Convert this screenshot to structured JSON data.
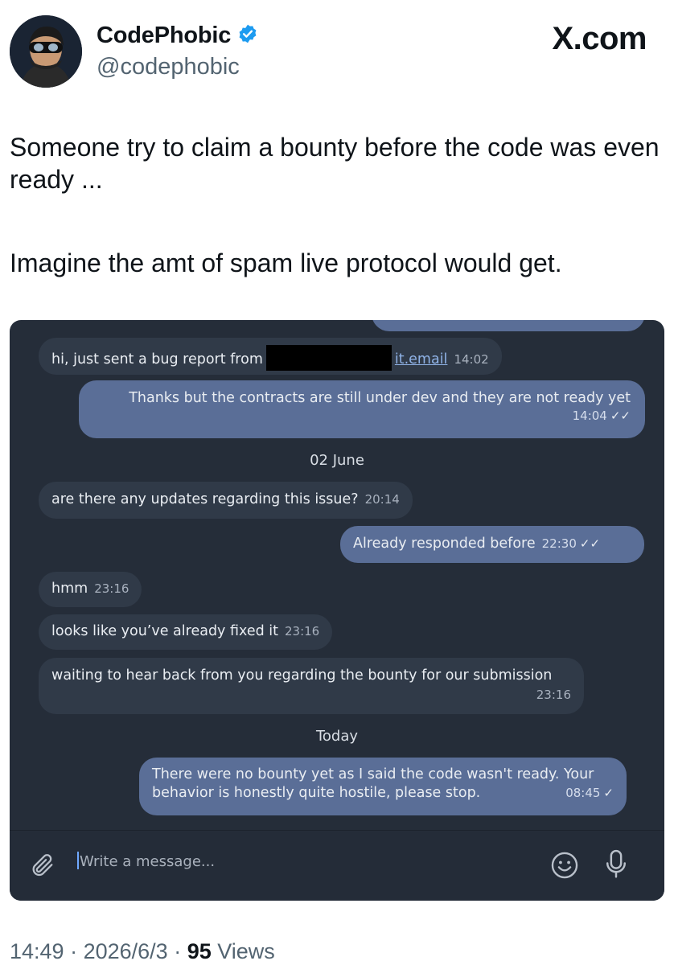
{
  "header": {
    "name": "CodePhobic",
    "handle": "@codephobic",
    "site": "X.com"
  },
  "tweet": {
    "line1": "Someone try to claim a bounty before the code was even ready ...",
    "line2": "Imagine the amt of spam live protocol would get."
  },
  "chat": {
    "messages": [
      {
        "text_before": "hi, just sent a bug report from",
        "text_after": "it.email",
        "time": "14:02"
      },
      {
        "text": "Thanks but the contracts are still under dev and they are not ready yet",
        "time": "14:04"
      },
      {
        "divider": "02 June"
      },
      {
        "text": "are there any updates regarding this issue?",
        "time": "20:14"
      },
      {
        "text": "Already responded before",
        "time": "22:30"
      },
      {
        "text": "hmm",
        "time": "23:16"
      },
      {
        "text": "looks like you’ve already fixed it",
        "time": "23:16"
      },
      {
        "text": "waiting to hear back from you regarding the bounty for our submission",
        "time": "23:16"
      },
      {
        "divider": "Today"
      },
      {
        "text_l1": "There were no bounty yet as I said the code wasn't ready. Your",
        "text_l2": "behavior is honestly quite hostile, please stop.",
        "time": "08:45"
      }
    ],
    "composer_placeholder": "Write a message...",
    "icons": [
      "paperclip-icon",
      "emoji-icon",
      "microphone-icon"
    ]
  },
  "footer": {
    "time": "14:49",
    "date": "2026/6/3",
    "views": "95",
    "views_label": "Views"
  },
  "colors": {
    "chat_bg": "#252d39",
    "incoming_bubble": "#303a48",
    "outgoing_bubble": "#5a6e97",
    "verified": "#1d9bf0"
  }
}
